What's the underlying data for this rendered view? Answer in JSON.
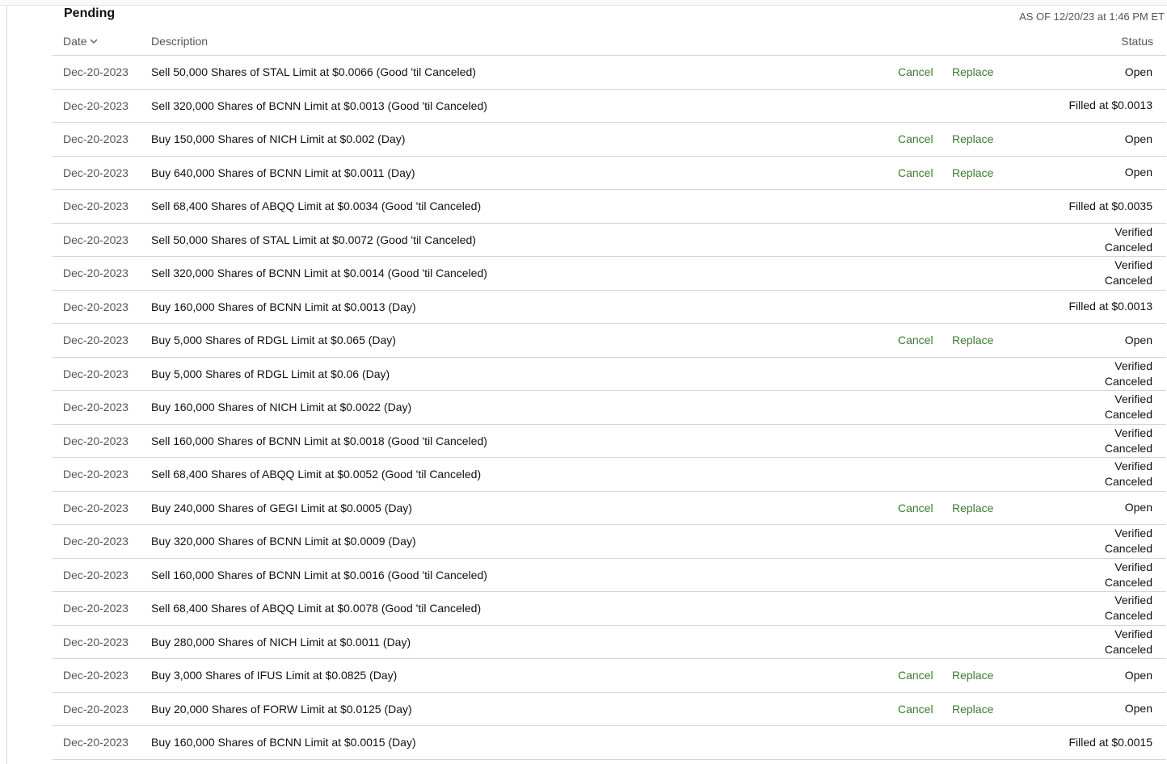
{
  "section_title": "Pending",
  "as_of": "AS OF 12/20/23 at 1:46 PM ET",
  "headers": {
    "date": "Date",
    "description": "Description",
    "status": "Status"
  },
  "actions": {
    "cancel": "Cancel",
    "replace": "Replace"
  },
  "orders": [
    {
      "date": "Dec-20-2023",
      "description": "Sell 50,000 Shares of STAL Limit at $0.0066 (Good 'til Canceled)",
      "status": "Open",
      "actions": true
    },
    {
      "date": "Dec-20-2023",
      "description": "Sell 320,000 Shares of BCNN Limit at $0.0013 (Good 'til Canceled)",
      "status": "Filled at $0.0013",
      "actions": false
    },
    {
      "date": "Dec-20-2023",
      "description": "Buy 150,000 Shares of NICH Limit at $0.002 (Day)",
      "status": "Open",
      "actions": true
    },
    {
      "date": "Dec-20-2023",
      "description": "Buy 640,000 Shares of BCNN Limit at $0.0011 (Day)",
      "status": "Open",
      "actions": true
    },
    {
      "date": "Dec-20-2023",
      "description": "Sell 68,400 Shares of ABQQ Limit at $0.0034 (Good 'til Canceled)",
      "status": "Filled at $0.0035",
      "actions": false
    },
    {
      "date": "Dec-20-2023",
      "description": "Sell 50,000 Shares of STAL Limit at $0.0072 (Good 'til Canceled)",
      "status": "Verified Canceled",
      "actions": false
    },
    {
      "date": "Dec-20-2023",
      "description": "Sell 320,000 Shares of BCNN Limit at $0.0014 (Good 'til Canceled)",
      "status": "Verified Canceled",
      "actions": false
    },
    {
      "date": "Dec-20-2023",
      "description": "Buy 160,000 Shares of BCNN Limit at $0.0013 (Day)",
      "status": "Filled at $0.0013",
      "actions": false
    },
    {
      "date": "Dec-20-2023",
      "description": "Buy 5,000 Shares of RDGL Limit at $0.065 (Day)",
      "status": "Open",
      "actions": true
    },
    {
      "date": "Dec-20-2023",
      "description": "Buy 5,000 Shares of RDGL Limit at $0.06 (Day)",
      "status": "Verified Canceled",
      "actions": false
    },
    {
      "date": "Dec-20-2023",
      "description": "Buy 160,000 Shares of NICH Limit at $0.0022 (Day)",
      "status": "Verified Canceled",
      "actions": false
    },
    {
      "date": "Dec-20-2023",
      "description": "Sell 160,000 Shares of BCNN Limit at $0.0018 (Good 'til Canceled)",
      "status": "Verified Canceled",
      "actions": false
    },
    {
      "date": "Dec-20-2023",
      "description": "Sell 68,400 Shares of ABQQ Limit at $0.0052 (Good 'til Canceled)",
      "status": "Verified Canceled",
      "actions": false
    },
    {
      "date": "Dec-20-2023",
      "description": "Buy 240,000 Shares of GEGI Limit at $0.0005 (Day)",
      "status": "Open",
      "actions": true
    },
    {
      "date": "Dec-20-2023",
      "description": "Buy 320,000 Shares of BCNN Limit at $0.0009 (Day)",
      "status": "Verified Canceled",
      "actions": false
    },
    {
      "date": "Dec-20-2023",
      "description": "Sell 160,000 Shares of BCNN Limit at $0.0016 (Good 'til Canceled)",
      "status": "Verified Canceled",
      "actions": false
    },
    {
      "date": "Dec-20-2023",
      "description": "Sell 68,400 Shares of ABQQ Limit at $0.0078 (Good 'til Canceled)",
      "status": "Verified Canceled",
      "actions": false
    },
    {
      "date": "Dec-20-2023",
      "description": "Buy 280,000 Shares of NICH Limit at $0.0011 (Day)",
      "status": "Verified Canceled",
      "actions": false
    },
    {
      "date": "Dec-20-2023",
      "description": "Buy 3,000 Shares of IFUS Limit at $0.0825 (Day)",
      "status": "Open",
      "actions": true
    },
    {
      "date": "Dec-20-2023",
      "description": "Buy 20,000 Shares of FORW Limit at $0.0125 (Day)",
      "status": "Open",
      "actions": true
    },
    {
      "date": "Dec-20-2023",
      "description": "Buy 160,000 Shares of BCNN Limit at $0.0015 (Day)",
      "status": "Filled at $0.0015",
      "actions": false
    }
  ]
}
